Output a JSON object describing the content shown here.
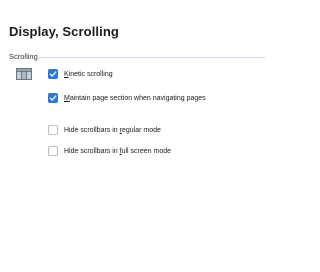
{
  "page": {
    "title": "Display, Scrolling"
  },
  "group": {
    "label": "Scrolling",
    "icon": "scrolling-section-icon"
  },
  "options": [
    {
      "pre": "",
      "u": "K",
      "post": "inetic scrolling",
      "checked": true
    },
    {
      "pre": "",
      "u": "M",
      "post": "aintain page section when navigating pages",
      "checked": true
    },
    {
      "pre": "Hide scrollbars in ",
      "u": "r",
      "post": "egular mode",
      "checked": false
    },
    {
      "pre": "Hide scrollbars in ",
      "u": "f",
      "post": "ull screen mode",
      "checked": false
    }
  ],
  "colors": {
    "accent": "#2f78d3",
    "rule": "#cdd6e3"
  }
}
